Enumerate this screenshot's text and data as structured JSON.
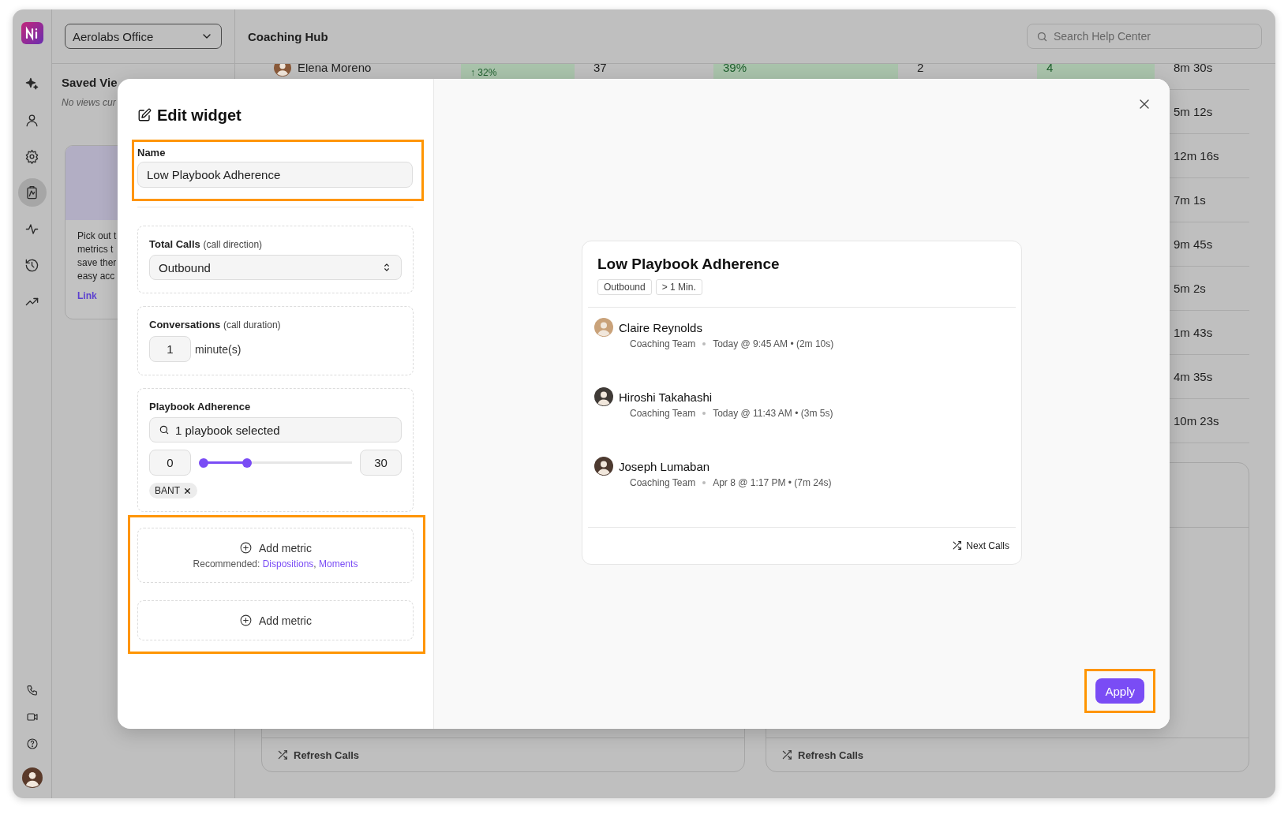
{
  "rail": {
    "items": [
      {
        "selected": false
      },
      {
        "selected": false
      },
      {
        "selected": false
      },
      {
        "selected": true
      },
      {
        "selected": false
      },
      {
        "selected": false
      },
      {
        "selected": false
      }
    ]
  },
  "workspace": {
    "value": "Aerolabs Office"
  },
  "page_title": "Coaching Hub",
  "search": {
    "placeholder": "Search Help Center"
  },
  "saved_views": {
    "title": "Saved Vie",
    "empty_text": "No views cur"
  },
  "promo_card": {
    "lines": [
      "Pick out t",
      "metrics t",
      "save ther",
      "easy acc"
    ],
    "link": "Link"
  },
  "table": {
    "first_row": {
      "name": "Elena Moreno",
      "cells": [
        {
          "text": "↑ 32%",
          "kind": "good"
        },
        {
          "text": "37",
          "kind": "plain"
        },
        {
          "text": "39%",
          "kind": "good"
        },
        {
          "text": "2",
          "kind": "plain"
        },
        {
          "text": "4",
          "kind": "good"
        }
      ]
    },
    "durations": [
      "8m 30s",
      "5m 12s",
      "12m 16s",
      "7m 1s",
      "9m 45s",
      "5m 2s",
      "1m 43s",
      "4m 35s",
      "10m 23s"
    ]
  },
  "cards": [
    {
      "footer": "Refresh Calls"
    },
    {
      "footer": "Refresh Calls"
    }
  ],
  "modal": {
    "title": "Edit widget",
    "name_field": {
      "label": "Name",
      "value": "Low Playbook Adherence",
      "highlighted": true
    },
    "filters": [
      {
        "kind": "select",
        "label": "Total Calls",
        "hint": "(call direction)",
        "value": "Outbound"
      },
      {
        "kind": "number",
        "label": "Conversations",
        "hint": "(call duration)",
        "value": "1",
        "unit": "minute(s)"
      },
      {
        "kind": "range",
        "label": "Playbook Adherence",
        "search_value": "1 playbook selected",
        "min": "0",
        "max": "30",
        "level": 0.3,
        "tags": [
          "BANT"
        ]
      }
    ],
    "add_metrics": {
      "highlighted": true,
      "items": [
        {
          "label": "Add metric",
          "recommended_label": "Recommended:",
          "links": [
            "Dispositions",
            "Moments"
          ],
          "separator": ","
        },
        {
          "label": "Add metric"
        }
      ]
    },
    "preview": {
      "title": "Low Playbook Adherence",
      "tags": [
        "Outbound",
        "> 1 Min."
      ],
      "calls": [
        {
          "name": "Claire Reynolds",
          "team": "Coaching Team",
          "when": "Today @ 9:45 AM • (2m 10s)"
        },
        {
          "name": "Hiroshi Takahashi",
          "team": "Coaching Team",
          "when": "Today @ 11:43 AM • (3m 5s)"
        },
        {
          "name": "Joseph Lumaban",
          "team": "Coaching Team",
          "when": "Apr 8 @ 1:17 PM • (7m 24s)"
        }
      ],
      "footer_action": "Next Calls"
    },
    "apply": {
      "label": "Apply",
      "highlighted": true
    }
  }
}
